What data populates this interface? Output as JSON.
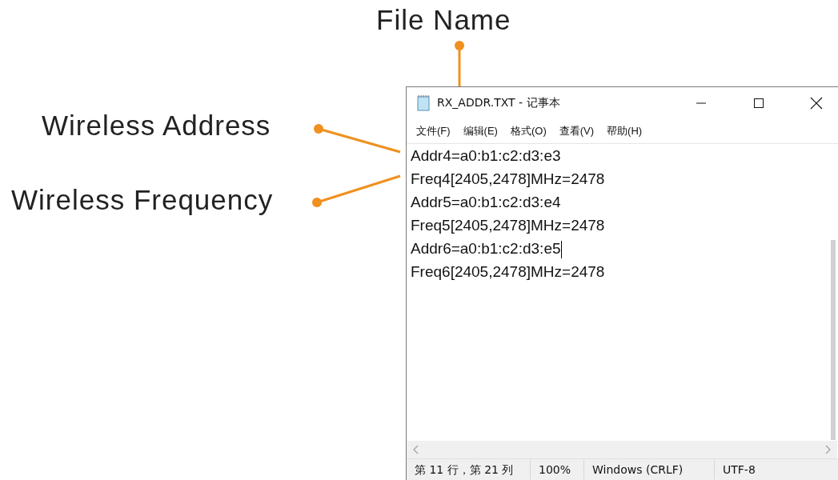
{
  "callouts": [
    {
      "kind": "top",
      "label": "File Name"
    },
    {
      "kind": "upper",
      "label": "Wireless Address"
    },
    {
      "kind": "lower",
      "label": "Wireless Frequency"
    }
  ],
  "window": {
    "title": "RX_ADDR.TXT - 记事本"
  },
  "menu": [
    "文件(F)",
    "编辑(E)",
    "格式(O)",
    "查看(V)",
    "帮助(H)"
  ],
  "editor": {
    "lines": [
      {
        "text": "Addr4=a0:b1:c2:d3:e3",
        "caret": false
      },
      {
        "text": "Freq4[2405,2478]MHz=2478",
        "caret": false
      },
      {
        "text": "Addr5=a0:b1:c2:d3:e4",
        "caret": false
      },
      {
        "text": "Freq5[2405,2478]MHz=2478",
        "caret": false
      },
      {
        "text": "Addr6=a0:b1:c2:d3:e5",
        "caret": true
      },
      {
        "text": "Freq6[2405,2478]MHz=2478",
        "caret": false
      }
    ]
  },
  "status_bar": [
    "第 11 行，第 21 列",
    "100%",
    "Windows (CRLF)",
    "UTF-8"
  ]
}
